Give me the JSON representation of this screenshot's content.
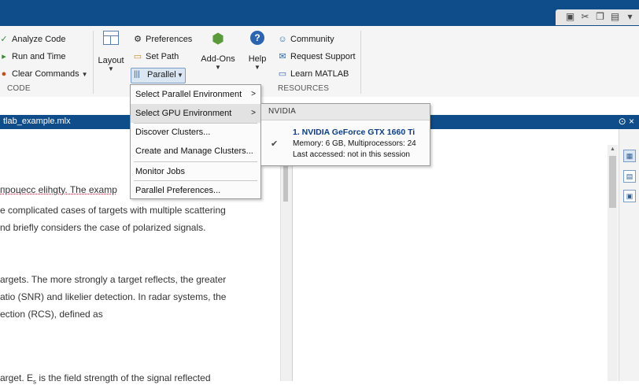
{
  "quick_access_icons": [
    "save-icon",
    "cut-icon",
    "copy-icon",
    "paste-icon",
    "dropdown-icon"
  ],
  "ribbon": {
    "code_group": {
      "items": [
        {
          "label": "Analyze Code",
          "icon": "analyze-code-icon"
        },
        {
          "label": "Run and Time",
          "icon": "run-and-time-icon"
        },
        {
          "label": "Clear Commands",
          "icon": "clear-commands-icon"
        }
      ],
      "group_label": "CODE"
    },
    "environment_group": {
      "layout_label": "Layout",
      "preferences_label": "Preferences",
      "set_path_label": "Set Path",
      "parallel_label": "Parallel",
      "addons_label": "Add-Ons"
    },
    "resources_group": {
      "help_label": "Help",
      "community_label": "Community",
      "request_support_label": "Request Support",
      "learn_matlab_label": "Learn MATLAB",
      "group_label": "RESOURCES"
    }
  },
  "editor_tab": {
    "title": "tlab_example.mlx",
    "controls": "⊙ ×"
  },
  "editor_lines": {
    "l1": "процесс elihgty. The examp",
    "l2": "e complicated cases of targets with multiple scattering",
    "l3": "nd briefly considers the case of polarized signals.",
    "l4": "argets. The more strongly a target reflects, the greater",
    "l5": "atio (SNR) and likelier detection. In radar systems, the",
    "l6": "ection (RCS), defined as",
    "l7": "arget.  E",
    "l7_sub": "s",
    "l7_rest": " is the field strength of the signal reflected"
  },
  "parallel_menu": {
    "items": [
      {
        "label": "Select Parallel Environment",
        "has_submenu": true
      },
      {
        "label": "Select GPU Environment",
        "has_submenu": true,
        "highlighted": true
      },
      {
        "label": "Discover Clusters...",
        "has_submenu": false
      },
      {
        "label": "Create and Manage Clusters...",
        "has_submenu": false
      },
      {
        "label": "Monitor Jobs",
        "has_submenu": false
      },
      {
        "label": "Parallel Preferences...",
        "has_submenu": false
      }
    ]
  },
  "gpu_menu": {
    "header": "NVIDIA",
    "device_name": "1. NVIDIA GeForce GTX 1660 Ti",
    "memory": "Memory: 6 GB, Multiprocessors: 24",
    "last_accessed": "Last accessed: not in this session",
    "selected": true
  },
  "colors": {
    "title_bar": "#0f4c8a",
    "ribbon_bg": "#f5f5f5",
    "gpu_name": "#0a3f85"
  }
}
